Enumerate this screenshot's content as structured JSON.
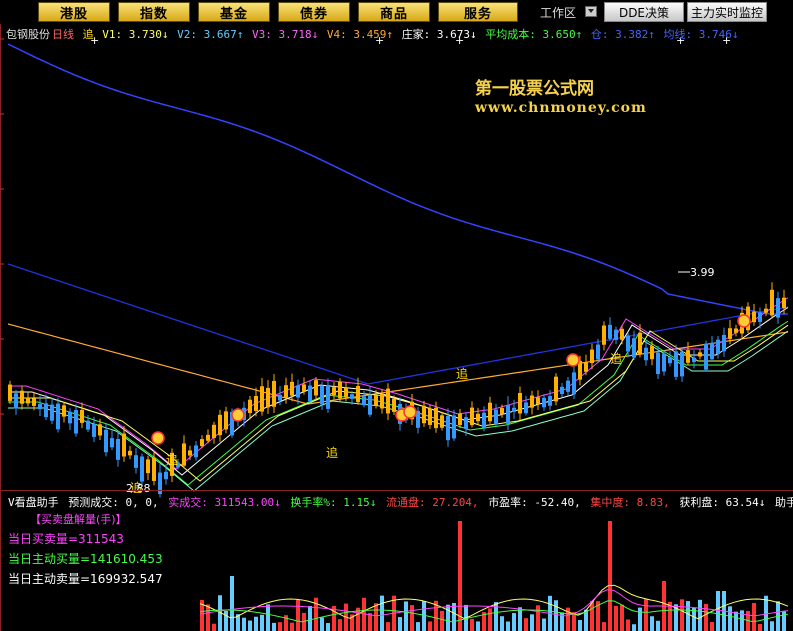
{
  "toolbar": {
    "buttons": [
      "港股",
      "指数",
      "基金",
      "债券",
      "商品",
      "服务"
    ],
    "workarea_label": "工作区",
    "dde_label": "DDE决策",
    "monitor_label": "主力实时监控"
  },
  "header": {
    "stock_name": "包钢股份",
    "period": "日线",
    "chase_marker": "追",
    "v1": "V1: 3.730↓",
    "v2": "V2: 3.667↑",
    "v3": "V3: 3.718↓",
    "v4": "V4: 3.459↑",
    "zhuangjia": "庄家: 3.673↓",
    "avg_cost": "平均成本: 3.650↑",
    "cang": "仓: 3.382↑",
    "junxian": "均线: 3.746↓"
  },
  "watermark": {
    "line1": "第一股票公式网",
    "line2": "www.chnmoney.com"
  },
  "chart_markers": {
    "high_label": "3.99",
    "low_label": "2.88",
    "chase": "追"
  },
  "sub_panel": {
    "title": "V看盘助手",
    "forecast": "预测成交: 0, 0,",
    "real_volume": "实成交: 311543.00↓",
    "turnover": "换手率%: 1.15↓",
    "float": "流通盘: 27.204,",
    "pe": "市盈率: -52.40,",
    "concentration": "集中度: 8.83,",
    "profit": "获利盘: 63.54↓",
    "helper": "助手排序:",
    "section": "【买卖盘解量(手)】",
    "buy_sell": "当日买卖量=311543",
    "active_buy": "当日主动买量=141610.453",
    "active_sell": "当日主动卖量=169932.547"
  },
  "colors": {
    "up": "#ff3333",
    "down": "#33aaff",
    "candle_up": "#ffb000",
    "gold": "#f5d24a"
  }
}
